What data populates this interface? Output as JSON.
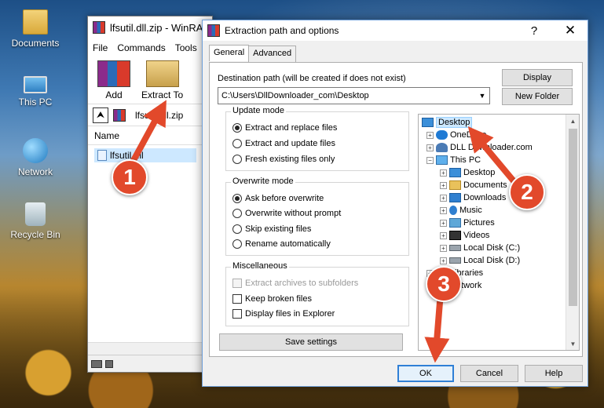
{
  "desktop": {
    "icons": [
      {
        "label": "Documents",
        "icon": "documents-folder-icon"
      },
      {
        "label": "This PC",
        "icon": "this-pc-icon"
      },
      {
        "label": "Network",
        "icon": "network-icon"
      },
      {
        "label": "Recycle Bin",
        "icon": "recycle-bin-icon"
      }
    ]
  },
  "winrar": {
    "title": "lfsutil.dll.zip - WinRAR",
    "menu": [
      "File",
      "Commands",
      "Tools"
    ],
    "toolbar": {
      "add_label": "Add",
      "extract_label": "Extract To"
    },
    "path": "lfsutil.dll.zip",
    "column_name": "Name",
    "file": "lfsutil.dll"
  },
  "dialog": {
    "title": "Extraction path and options",
    "help_glyph": "?",
    "close_glyph": "✕",
    "tabs": [
      "General",
      "Advanced"
    ],
    "destination_label": "Destination path (will be created if does not exist)",
    "destination_value": "C:\\Users\\DllDownloader_com\\Desktop",
    "display_button": "Display",
    "new_folder_button": "New Folder",
    "update_mode": {
      "title": "Update mode",
      "options": [
        "Extract and replace files",
        "Extract and update files",
        "Fresh existing files only"
      ],
      "selected": "Extract and replace files"
    },
    "overwrite_mode": {
      "title": "Overwrite mode",
      "options": [
        "Ask before overwrite",
        "Overwrite without prompt",
        "Skip existing files",
        "Rename automatically"
      ],
      "selected": "Ask before overwrite"
    },
    "misc": {
      "title": "Miscellaneous",
      "options": [
        "Extract archives to subfolders",
        "Keep broken files",
        "Display files in Explorer"
      ]
    },
    "save_settings": "Save settings",
    "tree": [
      {
        "label": "Desktop",
        "selected": true
      },
      {
        "label": "OneDrive"
      },
      {
        "label": "DLL Downloader.com"
      },
      {
        "label": "This PC"
      },
      {
        "label": "Desktop"
      },
      {
        "label": "Documents"
      },
      {
        "label": "Downloads"
      },
      {
        "label": "Music"
      },
      {
        "label": "Pictures"
      },
      {
        "label": "Videos"
      },
      {
        "label": "Local Disk (C:)"
      },
      {
        "label": "Local Disk (D:)"
      },
      {
        "label": "Libraries"
      },
      {
        "label": "Network"
      }
    ],
    "ok": "OK",
    "cancel": "Cancel",
    "help": "Help"
  },
  "annotations": {
    "step1": "1",
    "step2": "2",
    "step3": "3",
    "arrow_color": "#e2492b"
  }
}
